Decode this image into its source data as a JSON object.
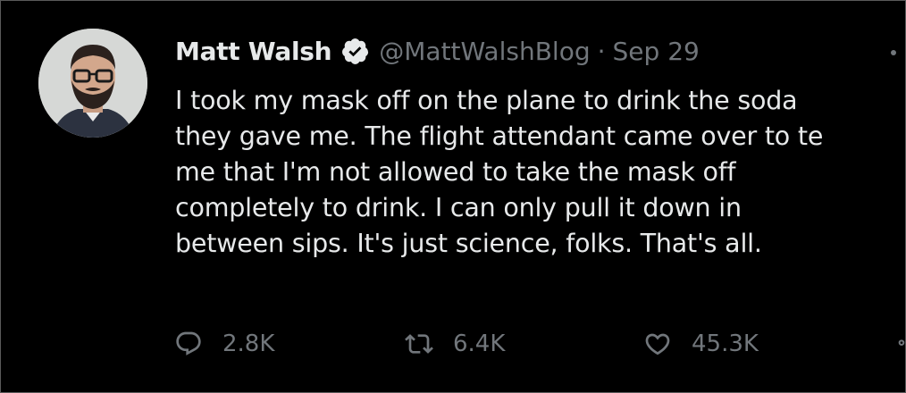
{
  "author": {
    "name": "Matt Walsh",
    "handle": "@MattWalshBlog",
    "separator": "·",
    "date": "Sep 29"
  },
  "tweet": {
    "lines": [
      "I took my mask off on the plane to drink the soda",
      "they gave me. The flight attendant came over to te",
      "me that I'm not allowed to take the mask off",
      "completely to drink. I can only pull it down in",
      "between sips. It's just science, folks. That's all."
    ]
  },
  "metrics": {
    "replies": "2.8K",
    "retweets": "6.4K",
    "likes": "45.3K"
  },
  "icons": {
    "verified": "verified-badge-icon",
    "more": "more-icon",
    "reply": "reply-icon",
    "retweet": "retweet-icon",
    "like": "heart-icon",
    "share": "share-icon"
  },
  "colors": {
    "background": "#000000",
    "text": "#e7e9ea",
    "secondary": "#71767b"
  }
}
